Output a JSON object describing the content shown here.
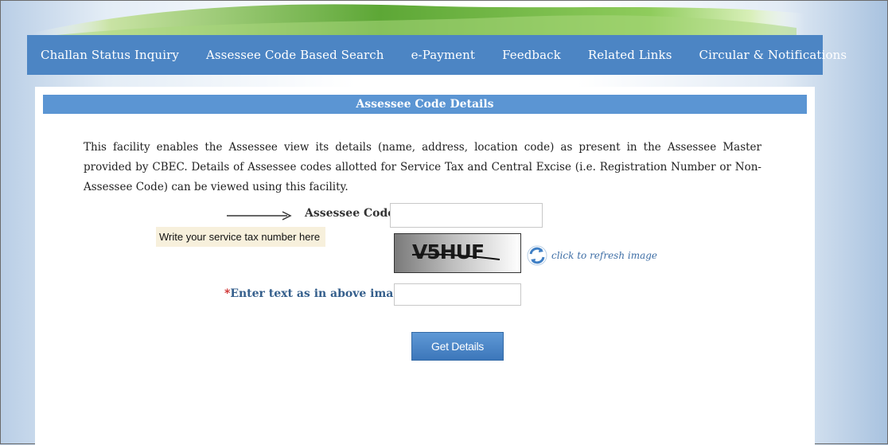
{
  "nav": {
    "items": [
      {
        "label": "Challan Status Inquiry"
      },
      {
        "label": "Assessee Code Based Search"
      },
      {
        "label": "e-Payment"
      },
      {
        "label": "Feedback"
      },
      {
        "label": "Related Links"
      },
      {
        "label": "Circular & Notifications"
      }
    ]
  },
  "panel": {
    "title": "Assessee Code Details",
    "description": "This facility enables the Assessee view its details (name, address, location code) as present in the Assessee Master provided by CBEC. Details of Assessee codes allotted for Service Tax and Central Excise (i.e. Registration Number or Non-Assessee Code) can be viewed using this facility."
  },
  "form": {
    "assessee_code_label": "Assessee Code:",
    "assessee_code_value": "",
    "tooltip": "Write your service tax number here",
    "captcha_text": "V5HUF",
    "refresh_label": "click to refresh image",
    "captcha_label_required": "*",
    "captcha_label": "Enter text as in above image:",
    "captcha_value": "",
    "submit_label": "Get Details"
  },
  "colors": {
    "nav_bg": "#4c85c4",
    "header_bg": "#5b95d3",
    "button_bg": "#3c77ba",
    "label_blue": "#355f8c",
    "required_red": "#cc2222"
  }
}
